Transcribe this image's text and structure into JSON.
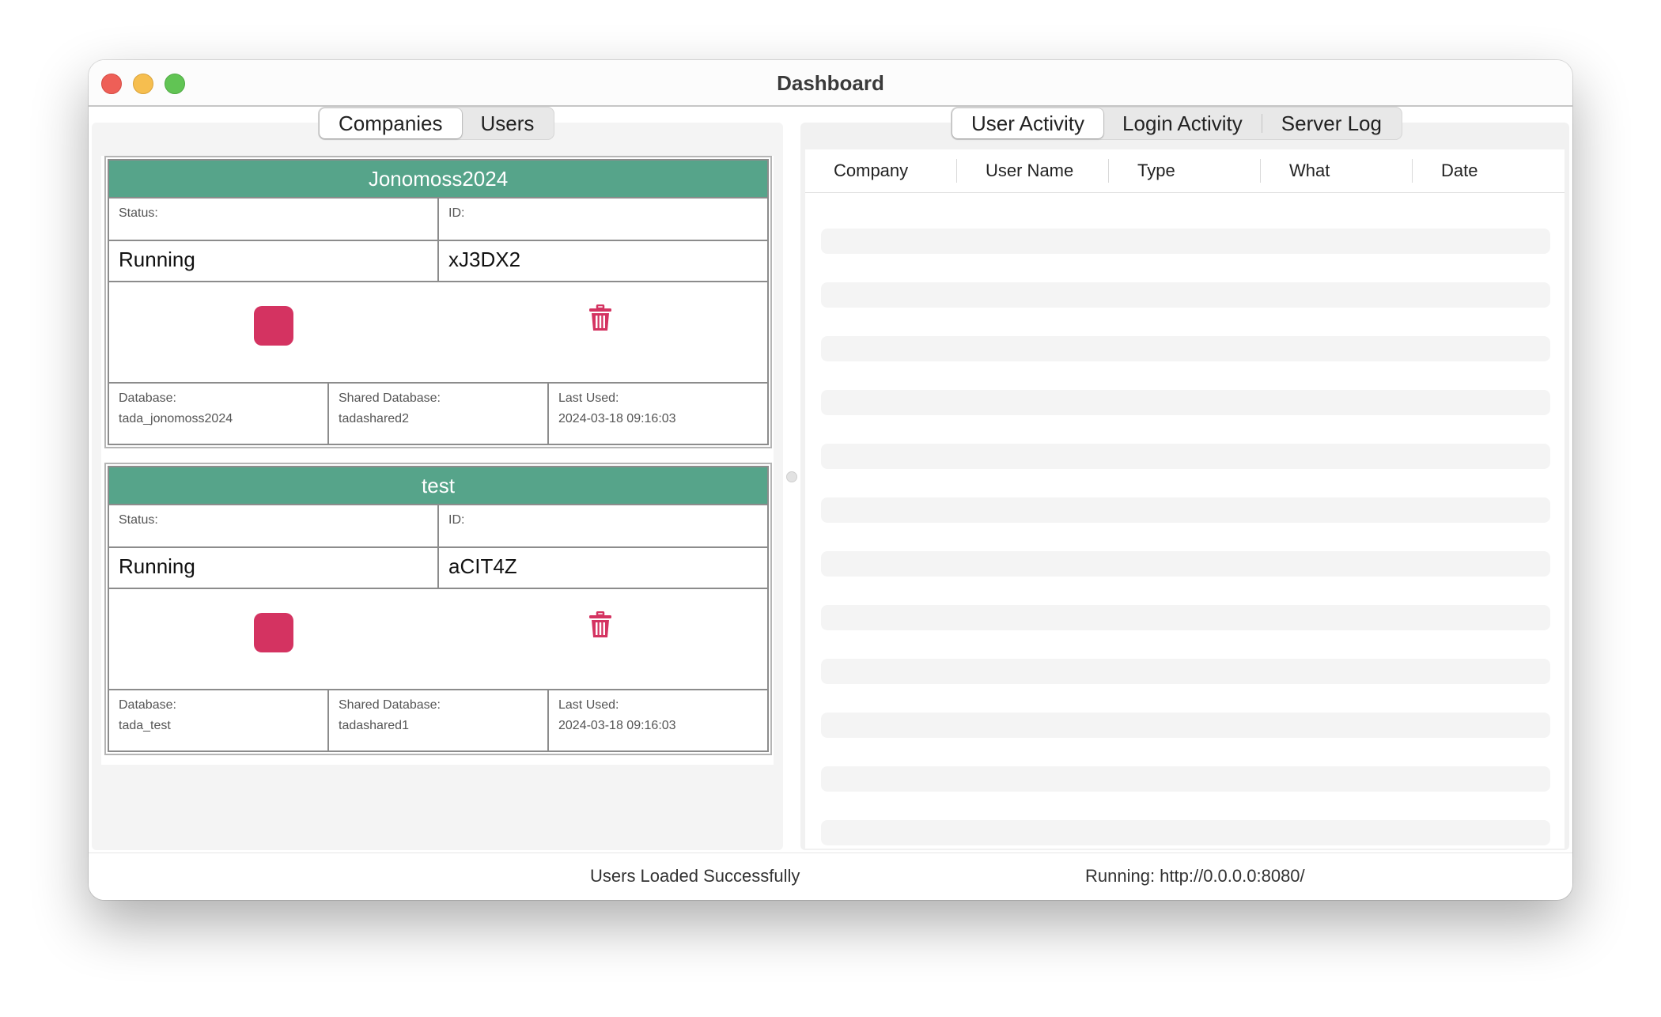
{
  "window": {
    "title": "Dashboard"
  },
  "left_tabs": [
    {
      "label": "Companies",
      "active": true
    },
    {
      "label": "Users",
      "active": false
    }
  ],
  "right_tabs": [
    {
      "label": "User Activity",
      "active": true
    },
    {
      "label": "Login Activity",
      "active": false
    },
    {
      "label": "Server Log",
      "active": false
    }
  ],
  "companies": [
    {
      "name": "Jonomoss2024",
      "status_label": "Status:",
      "status": "Running",
      "id_label": "ID:",
      "id": "xJ3DX2",
      "database_label": "Database:",
      "database": "tada_jonomoss2024",
      "shared_label": "Shared Database:",
      "shared": "tadashared2",
      "last_used_label": "Last Used:",
      "last_used": "2024-03-18 09:16:03"
    },
    {
      "name": "test",
      "status_label": "Status:",
      "status": "Running",
      "id_label": "ID:",
      "id": "aCIT4Z",
      "database_label": "Database:",
      "database": "tada_test",
      "shared_label": "Shared Database:",
      "shared": "tadashared1",
      "last_used_label": "Last Used:",
      "last_used": "2024-03-18 09:16:03"
    }
  ],
  "activity_table": {
    "columns": [
      "Company",
      "User Name",
      "Type",
      "What",
      "Date"
    ],
    "rows": []
  },
  "status_bar": {
    "message": "Users Loaded Successfully",
    "server": "Running: http://0.0.0.0:8080/"
  },
  "colors": {
    "card_header": "#56a48a",
    "stop_button": "#d43361",
    "trash_icon": "#d43361"
  }
}
